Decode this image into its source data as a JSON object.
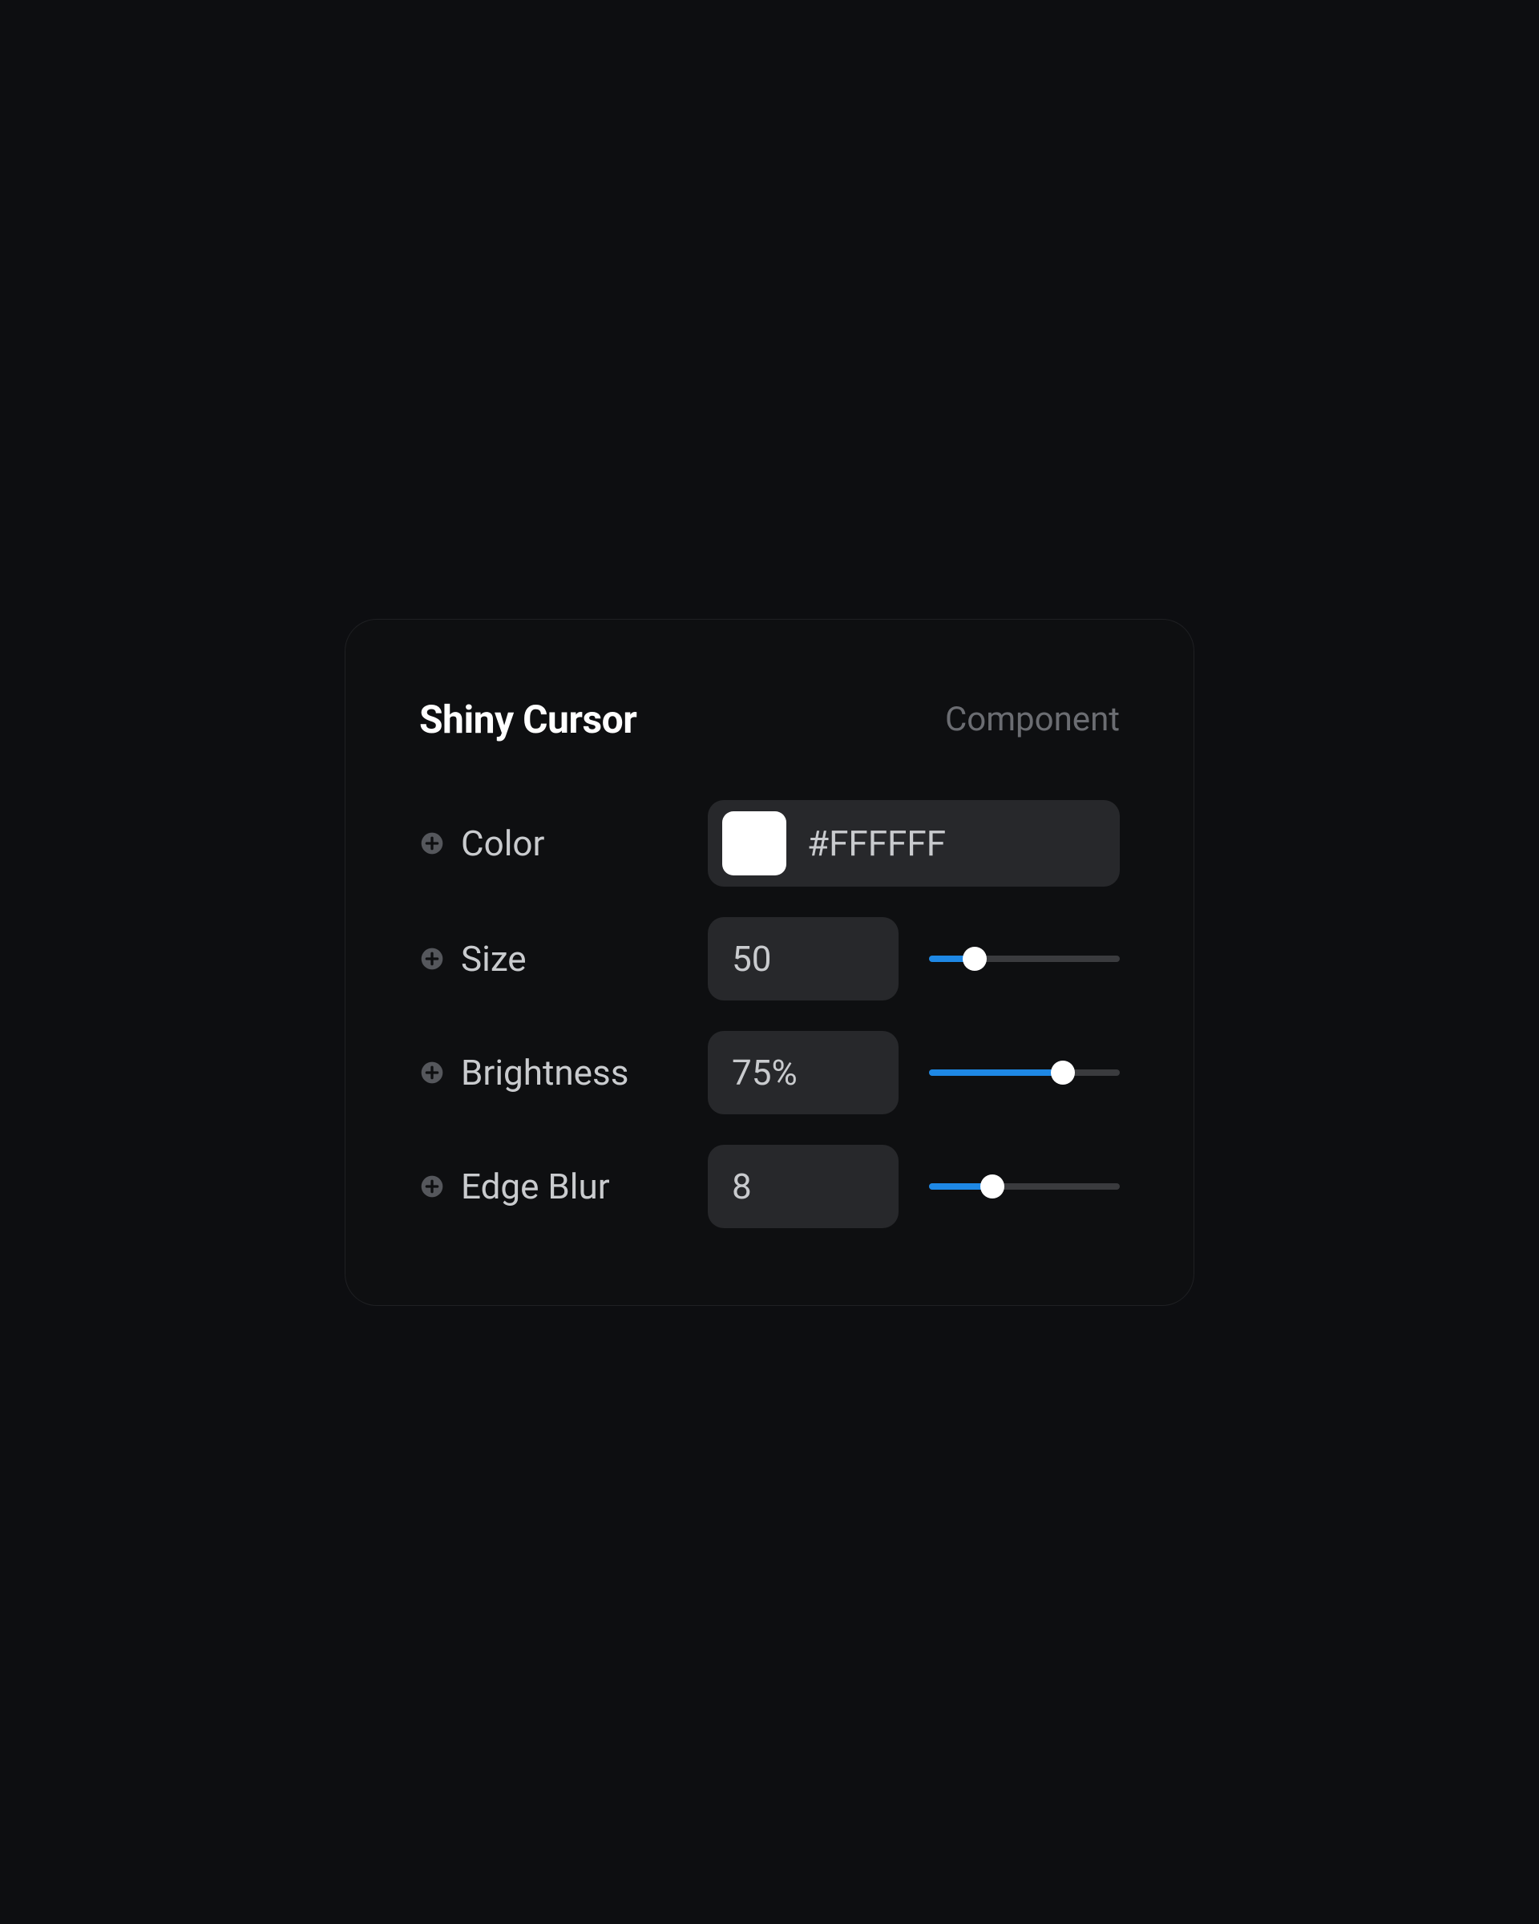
{
  "header": {
    "title": "Shiny Cursor",
    "subtitle": "Component"
  },
  "properties": {
    "color": {
      "label": "Color",
      "value": "#FFFFFF",
      "swatch": "#FFFFFF"
    },
    "size": {
      "label": "Size",
      "value": "50",
      "sliderPercent": 24
    },
    "brightness": {
      "label": "Brightness",
      "value": "75%",
      "sliderPercent": 70
    },
    "edgeBlur": {
      "label": "Edge Blur",
      "value": "8",
      "sliderPercent": 33
    }
  }
}
